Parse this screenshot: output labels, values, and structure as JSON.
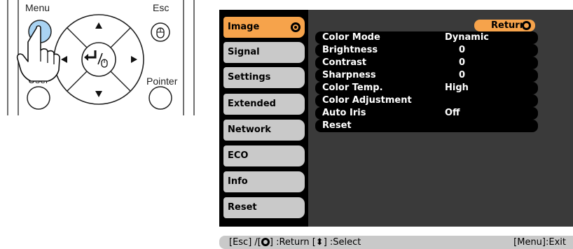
{
  "remote": {
    "menu_label": "Menu",
    "esc_label": "Esc",
    "user_label": "User",
    "pointer_label": "Pointer"
  },
  "tabs": [
    {
      "label": "Image",
      "active": true
    },
    {
      "label": "Signal"
    },
    {
      "label": "Settings"
    },
    {
      "label": "Extended"
    },
    {
      "label": "Network"
    },
    {
      "label": "ECO"
    },
    {
      "label": "Info"
    },
    {
      "label": "Reset"
    }
  ],
  "panel": {
    "return_label": "Return",
    "items": [
      {
        "label": "Color Mode",
        "value": "Dynamic"
      },
      {
        "label": "Brightness",
        "value": "0"
      },
      {
        "label": "Contrast",
        "value": "0"
      },
      {
        "label": "Sharpness",
        "value": "0"
      },
      {
        "label": "Color Temp.",
        "value": "High"
      },
      {
        "label": "Color Adjustment",
        "value": ""
      },
      {
        "label": "Auto Iris",
        "value": "Off"
      },
      {
        "label": "Reset",
        "value": ""
      }
    ]
  },
  "helpbar": {
    "left_pre": "[Esc] /[",
    "left_post": "] :Return [⬍] :Select",
    "right": "[Menu]:Exit"
  },
  "colors": {
    "accent": "#f6a34b",
    "menu_bg": "#000000",
    "panel_bg": "#3a3a3a",
    "tab_bg": "#c9c9c9",
    "menu_button_blue": "#a9d3f2"
  },
  "icons": [
    "enter-icon",
    "up-arrow-icon",
    "down-arrow-icon",
    "left-arrow-icon",
    "right-arrow-icon",
    "enter-mouse-icon",
    "mouse-icon",
    "hand-pointer-icon"
  ]
}
